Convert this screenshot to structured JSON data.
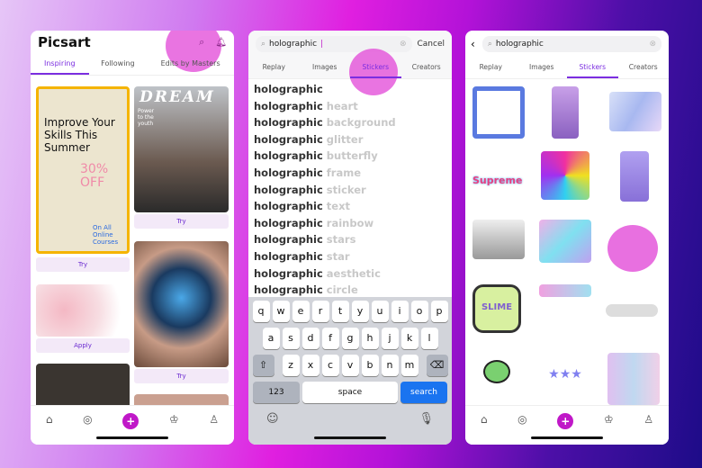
{
  "colors": {
    "accent": "#7b2ee0",
    "plus": "#c018c8",
    "highlight": "#e146d7",
    "search_blue": "#1a74f0"
  },
  "feed": {
    "logo": "Picsart",
    "tabs": [
      {
        "label": "Inspiring",
        "active": true
      },
      {
        "label": "Following"
      },
      {
        "label": "Edits by Masters"
      }
    ],
    "cards": [
      {
        "headline": "Improve Your Skills This Summer",
        "promo": "30% OFF",
        "sub": "On All Online Courses",
        "button": "Try"
      },
      {
        "headline": "DREAM",
        "sub": "Power to the youth",
        "button": "Try"
      },
      {
        "button": "Apply"
      },
      {
        "button": "Try"
      }
    ],
    "nav": [
      "home-icon",
      "compass-icon",
      "plus-icon",
      "trophy-icon",
      "profile-icon"
    ]
  },
  "search": {
    "query": "holographic",
    "cancel": "Cancel",
    "tabs": [
      {
        "label": "Replay"
      },
      {
        "label": "Images"
      },
      {
        "label": "Stickers",
        "active": true
      },
      {
        "label": "Creators"
      }
    ],
    "suggestions": [
      {
        "base": "holographic",
        "rest": ""
      },
      {
        "base": "holographic",
        "rest": "heart"
      },
      {
        "base": "holographic",
        "rest": "background"
      },
      {
        "base": "holographic",
        "rest": "glitter"
      },
      {
        "base": "holographic",
        "rest": "butterfly"
      },
      {
        "base": "holographic",
        "rest": "frame"
      },
      {
        "base": "holographic",
        "rest": "sticker"
      },
      {
        "base": "holographic",
        "rest": "text"
      },
      {
        "base": "holographic",
        "rest": "rainbow"
      },
      {
        "base": "holographic",
        "rest": "stars"
      },
      {
        "base": "holographic",
        "rest": "star"
      },
      {
        "base": "holographic",
        "rest": "aesthetic"
      },
      {
        "base": "holographic",
        "rest": "circle"
      }
    ],
    "keyboard": {
      "row1": [
        "q",
        "w",
        "e",
        "r",
        "t",
        "y",
        "u",
        "i",
        "o",
        "p"
      ],
      "row2": [
        "a",
        "s",
        "d",
        "f",
        "g",
        "h",
        "j",
        "k",
        "l"
      ],
      "row3": [
        "z",
        "x",
        "c",
        "v",
        "b",
        "n",
        "m"
      ],
      "numbers": "123",
      "space": "space",
      "search": "search"
    }
  },
  "results": {
    "query": "holographic",
    "tabs": [
      {
        "label": "Replay"
      },
      {
        "label": "Images"
      },
      {
        "label": "Stickers",
        "active": true
      },
      {
        "label": "Creators"
      }
    ],
    "sticker_texts": [
      "Supreme",
      "SLIME"
    ]
  }
}
